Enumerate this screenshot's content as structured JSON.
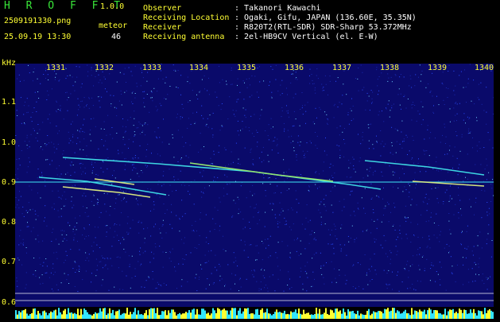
{
  "app": {
    "title": "H R O F F T",
    "version": "1.0.0",
    "file_name": "2509191330.png",
    "date_time": "25.09.19 13:30",
    "meteor_label": "meteor",
    "meteor_count": "46"
  },
  "info": [
    {
      "key": "Observer",
      "value": ": Takanori Kawachi"
    },
    {
      "key": "Receiving Location",
      "value": ": Ogaki, Gifu, JAPAN (136.60E, 35.35N)"
    },
    {
      "key": "Receiver",
      "value": ": R820T2(RTL-SDR) SDR-Sharp 53.372MHz"
    },
    {
      "key": "Receiving antenna",
      "value": ": 2el-HB9CV Vertical (el. E-W)"
    }
  ],
  "axes": {
    "y_unit": "kHz",
    "y_ticks": [
      "1.1",
      "1.0",
      "0.9",
      "0.8",
      "0.7",
      "0.6"
    ],
    "x_ticks": [
      "1331",
      "1332",
      "1333",
      "1334",
      "1335",
      "1336",
      "1337",
      "1338",
      "1339",
      "1340"
    ]
  },
  "colors": {
    "background": "#000000",
    "spectrum": "#0a0a6a",
    "signal": "#39e6e6",
    "label": "#ffff33",
    "title": "#39e639"
  }
}
